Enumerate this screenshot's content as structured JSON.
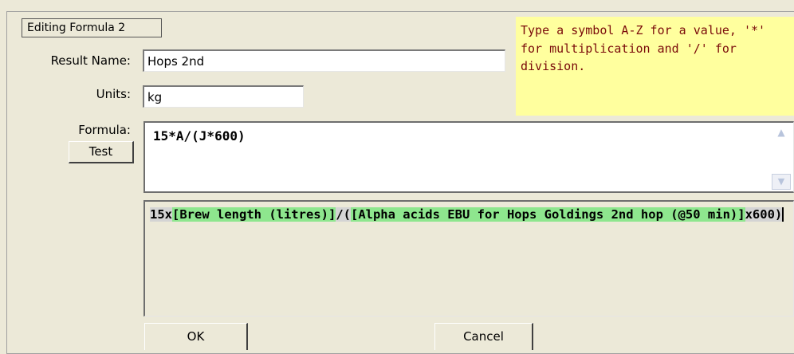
{
  "group": {
    "title": "Editing Formula 2"
  },
  "fields": {
    "result_name": {
      "label": "Result Name:",
      "value": "Hops 2nd"
    },
    "units": {
      "label": "Units:",
      "value": "kg"
    },
    "formula": {
      "label": "Formula:",
      "value": "15*A/(J*600)"
    }
  },
  "hint": {
    "text": "Type a symbol A-Z for a value, '*' for multiplication and '/' for division."
  },
  "buttons": {
    "test": "Test",
    "ok": "OK",
    "cancel": "Cancel"
  },
  "expanded": {
    "tokens": [
      {
        "text": "15x",
        "kind": "plain"
      },
      {
        "text": "[Brew length (litres)]",
        "kind": "field"
      },
      {
        "text": "/(",
        "kind": "plain"
      },
      {
        "text": "[Alpha acids EBU for Hops Goldings 2nd hop (@50 min)]",
        "kind": "field"
      },
      {
        "text": "x600)",
        "kind": "plain"
      }
    ]
  },
  "icons": {
    "scroll_up": "chevron-up-icon",
    "scroll_down": "chevron-down-icon"
  },
  "colors": {
    "hint_bg": "#ffff9e",
    "hint_text": "#7a0a0a",
    "field_highlight": "#8ee68e",
    "operator_highlight": "#d4d4d4",
    "dialog_bg": "#ece9d8"
  }
}
